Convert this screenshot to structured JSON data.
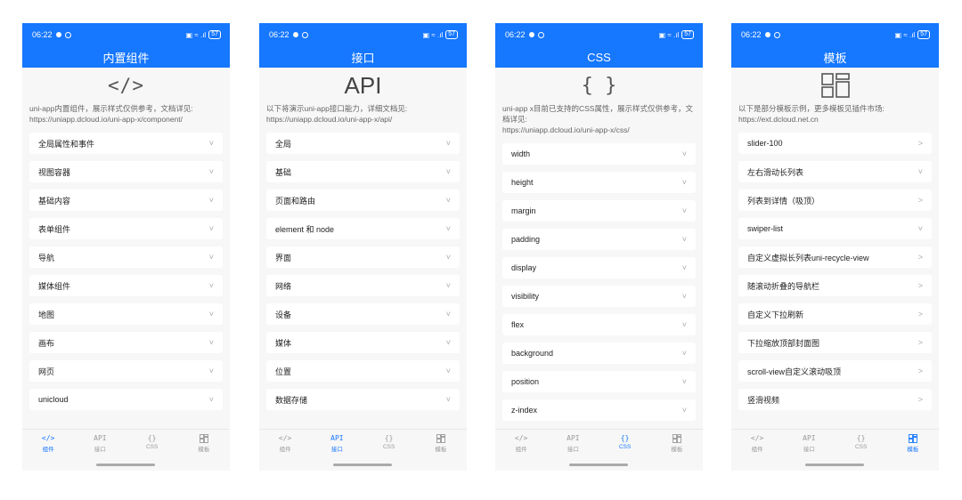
{
  "status": {
    "time": "06:22",
    "right": "▣ ≈ .ıl",
    "battery": "57"
  },
  "tabs": [
    {
      "label": "组件",
      "icon": "</>"
    },
    {
      "label": "接口",
      "icon": "API"
    },
    {
      "label": "CSS",
      "icon": "{}"
    },
    {
      "label": "模板",
      "icon": "grid"
    }
  ],
  "phones": [
    {
      "title": "内置组件",
      "hero": "</>",
      "desc": "uni-app内置组件，展示样式仅供参考，文档详见:\nhttps://uniapp.dcloud.io/uni-app-x/component/",
      "items": [
        "全局属性和事件",
        "视图容器",
        "基础内容",
        "表单组件",
        "导航",
        "媒体组件",
        "地图",
        "画布",
        "网页",
        "unicloud"
      ],
      "chevron": "˅",
      "active_tab": 0
    },
    {
      "title": "接口",
      "hero": "API",
      "desc": "以下将演示uni-app接口能力，详细文档见:\nhttps://uniapp.dcloud.io/uni-app-x/api/",
      "items": [
        "全局",
        "基础",
        "页面和路由",
        "element 和 node",
        "界面",
        "网络",
        "设备",
        "媒体",
        "位置",
        "数据存储"
      ],
      "chevron": "˅",
      "active_tab": 1
    },
    {
      "title": "CSS",
      "hero": "{ }",
      "desc": "uni-app x目前已支持的CSS属性，展示样式仅供参考，文档详见:\nhttps://uniapp.dcloud.io/uni-app-x/css/",
      "items": [
        "width",
        "height",
        "margin",
        "padding",
        "display",
        "visibility",
        "flex",
        "background",
        "position",
        "z-index"
      ],
      "chevron": "˅",
      "active_tab": 2
    },
    {
      "title": "模板",
      "hero": "grid",
      "desc": "以下是部分模板示例，更多模板见插件市场:\nhttps://ext.dcloud.net.cn",
      "items": [
        "slider-100",
        "左右滑动长列表",
        "列表到详情（吸顶）",
        "swiper-list",
        "自定义虚拟长列表uni-recycle-view",
        "随滚动折叠的导航栏",
        "自定义下拉刷新",
        "下拉缩放顶部封面图",
        "scroll-view自定义滚动吸顶",
        "竖滑视频"
      ],
      "chevrons": [
        ">",
        "˅",
        ">",
        "˅",
        ">",
        ">",
        ">",
        ">",
        ">",
        ">"
      ],
      "active_tab": 3
    }
  ],
  "colors": {
    "accent": "#1677ff",
    "bg": "#f7f7f7"
  }
}
